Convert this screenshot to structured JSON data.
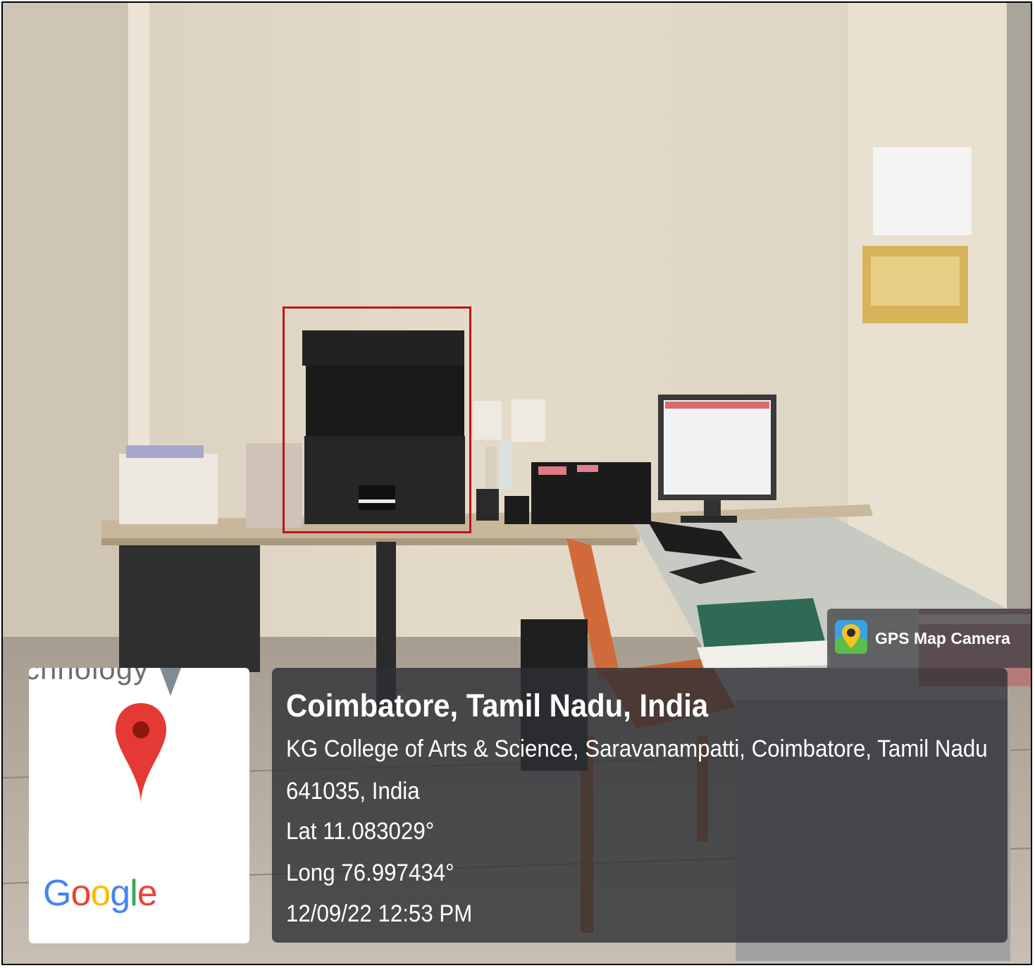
{
  "map_card": {
    "partial_label": "chnology",
    "logo_text": "Google",
    "logo_colors": [
      "#4285F4",
      "#EA4335",
      "#FBBC05",
      "#4285F4",
      "#34A853",
      "#EA4335"
    ],
    "pin_color": "#E53935"
  },
  "gps_badge": {
    "label": "GPS Map Camera",
    "icon": "gps-map-camera-app-icon"
  },
  "location": {
    "title": "Coimbatore, Tamil Nadu, India",
    "address_line1": "KG College of Arts & Science, Saravanampatti, Coimbatore, Tamil Nadu",
    "address_line2": "641035, India",
    "latitude": "Lat 11.083029°",
    "longitude": "Long 76.997434°",
    "datetime": "12/09/22 12:53 PM"
  },
  "annotation": {
    "highlight_color": "#C0141B",
    "highlighted_object": "printer"
  }
}
